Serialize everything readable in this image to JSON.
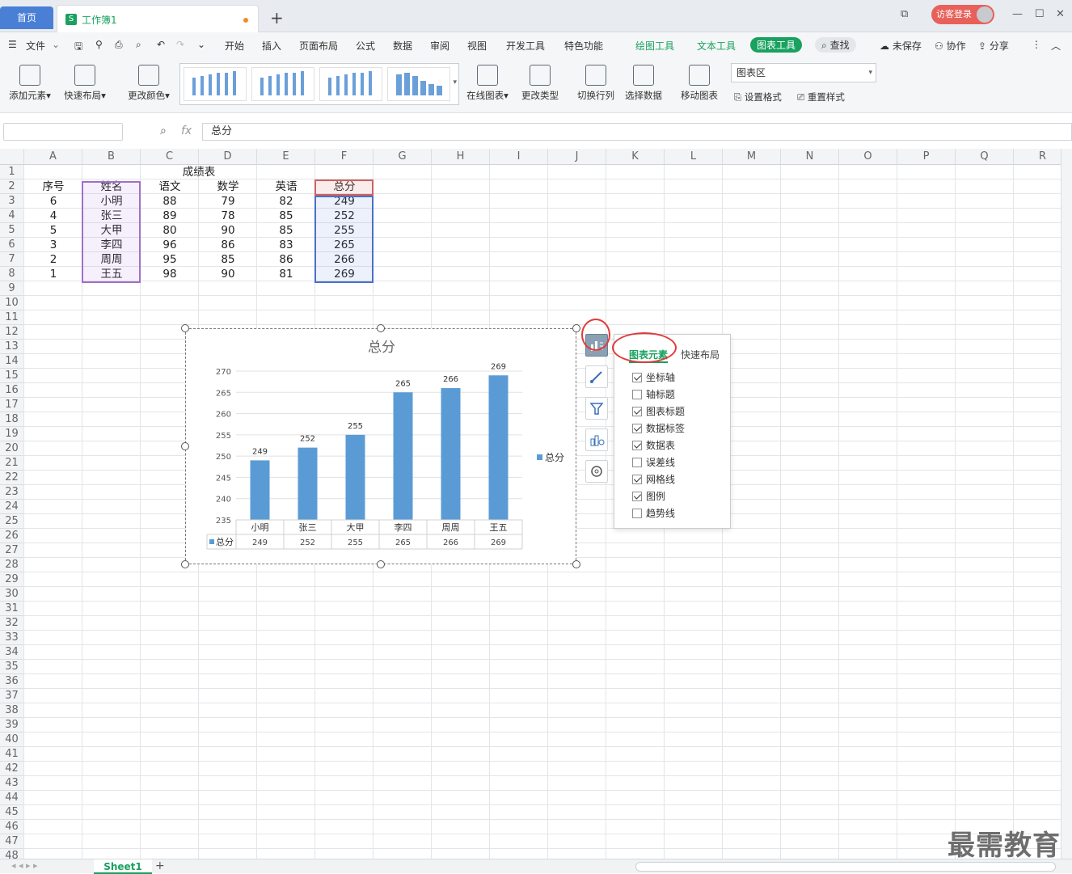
{
  "titlebar": {
    "home_tab": "首页",
    "book_tab": "工作簿1",
    "book_icon": "S",
    "login": "访客登录"
  },
  "menu": {
    "file": "文件",
    "items": [
      "开始",
      "插入",
      "页面布局",
      "公式",
      "数据",
      "审阅",
      "视图",
      "开发工具",
      "特色功能"
    ],
    "tools": [
      "绘图工具",
      "文本工具",
      "图表工具"
    ],
    "search": "查找",
    "right": [
      "未保存",
      "协作",
      "分享"
    ]
  },
  "ribbon": {
    "add_element": "添加元素",
    "quick_layout": "快速布局",
    "change_color": "更改颜色",
    "online_chart": "在线图表",
    "change_type": "更改类型",
    "switch_rowcol": "切换行列",
    "select_data": "选择数据",
    "move_chart": "移动图表",
    "chart_area_select": "图表区",
    "set_format": "设置格式",
    "reset_style": "重置样式"
  },
  "formula": {
    "namebox": "",
    "fx": "fx",
    "content": "总分"
  },
  "columns": [
    "A",
    "B",
    "C",
    "D",
    "E",
    "F",
    "G",
    "H",
    "I",
    "J",
    "K",
    "L",
    "M",
    "N",
    "O",
    "P",
    "Q",
    "R"
  ],
  "rows_count": 48,
  "sheet": {
    "title": "成绩表",
    "headers": [
      "序号",
      "姓名",
      "语文",
      "数学",
      "英语",
      "总分"
    ],
    "rows": [
      [
        "6",
        "小明",
        "88",
        "79",
        "82",
        "249"
      ],
      [
        "4",
        "张三",
        "89",
        "78",
        "85",
        "252"
      ],
      [
        "5",
        "大甲",
        "80",
        "90",
        "85",
        "255"
      ],
      [
        "3",
        "李四",
        "96",
        "86",
        "83",
        "265"
      ],
      [
        "2",
        "周周",
        "95",
        "85",
        "86",
        "266"
      ],
      [
        "1",
        "王五",
        "98",
        "90",
        "81",
        "269"
      ]
    ]
  },
  "chart_data": {
    "type": "bar",
    "title": "总分",
    "categories": [
      "小明",
      "张三",
      "大甲",
      "李四",
      "周周",
      "王五"
    ],
    "series": [
      {
        "name": "总分",
        "values": [
          249,
          252,
          255,
          265,
          266,
          269
        ],
        "color": "#5b9bd5"
      }
    ],
    "ylim": [
      235,
      270
    ],
    "yticks": [
      235,
      240,
      245,
      250,
      255,
      260,
      265,
      270
    ],
    "data_labels": true,
    "data_table": true,
    "legend": "right",
    "grid": true
  },
  "panel": {
    "tab_elements": "图表元素",
    "tab_layout": "快速布局",
    "options": [
      {
        "label": "坐标轴",
        "checked": true
      },
      {
        "label": "轴标题",
        "checked": false
      },
      {
        "label": "图表标题",
        "checked": true
      },
      {
        "label": "数据标签",
        "checked": true
      },
      {
        "label": "数据表",
        "checked": true
      },
      {
        "label": "误差线",
        "checked": false
      },
      {
        "label": "网格线",
        "checked": true
      },
      {
        "label": "图例",
        "checked": true
      },
      {
        "label": "趋势线",
        "checked": false
      }
    ]
  },
  "status": {
    "sheet_tab": "Sheet1"
  },
  "watermark": "最需教育"
}
